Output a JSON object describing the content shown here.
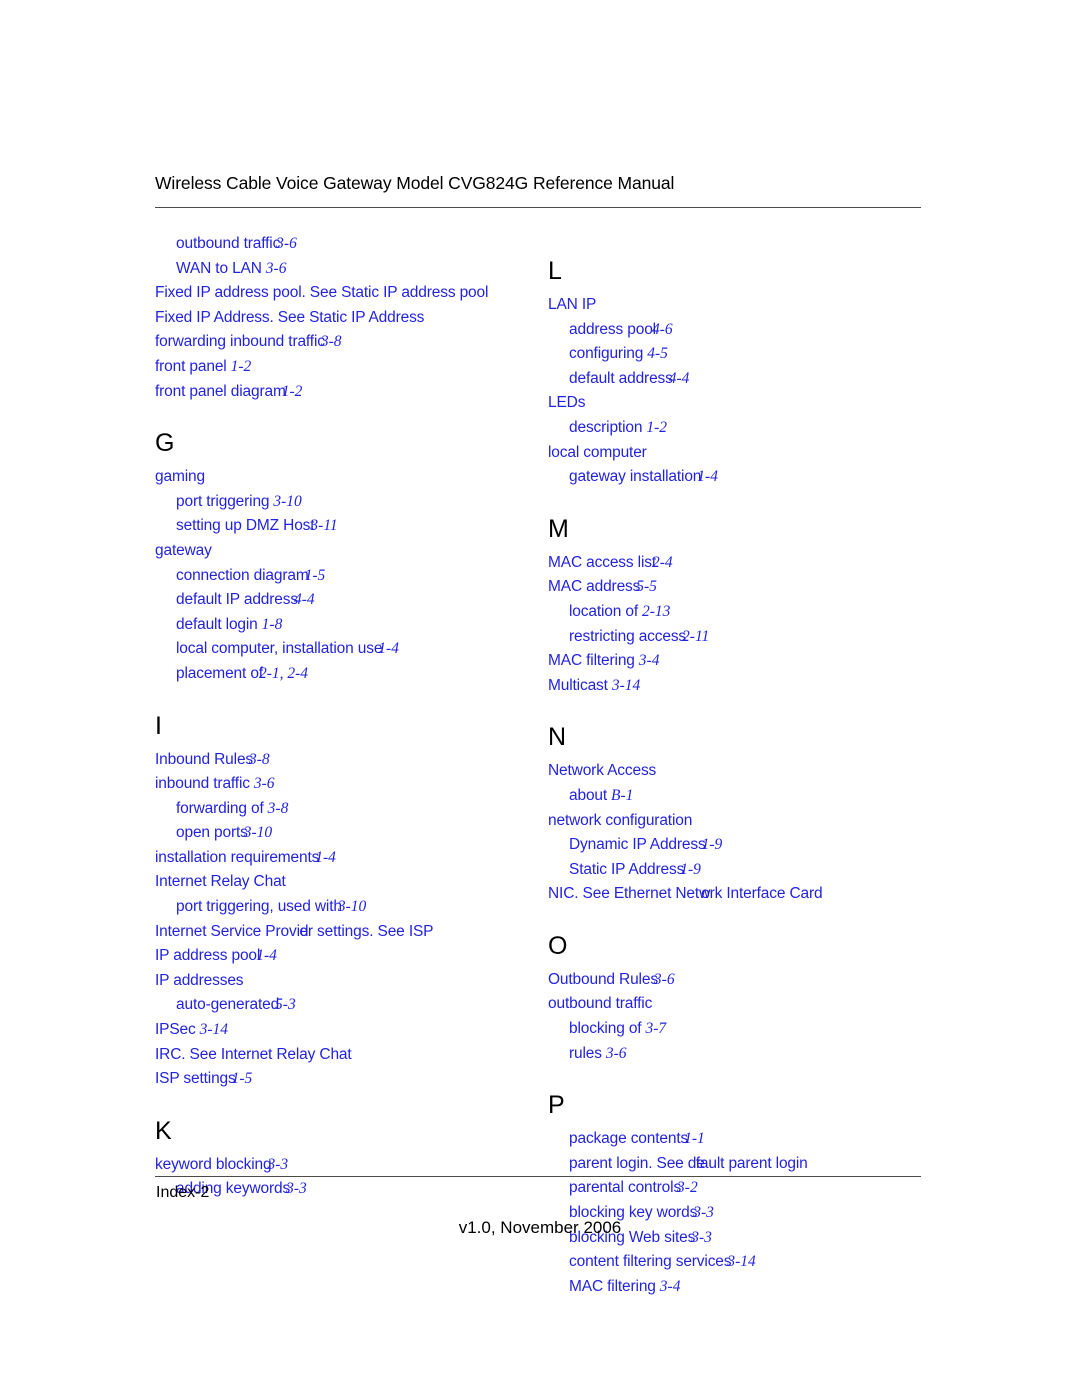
{
  "header": {
    "title": "Wireless Cable Voice Gateway Model CVG824G Reference Manual"
  },
  "footer": {
    "index_label": "Index-2",
    "version": "v1.0, November 2006"
  },
  "colors": {
    "link_blue": "#2323dd",
    "text_black": "#000000",
    "rule_gray": "#4a4a4a"
  },
  "columns": {
    "left": {
      "continued_entries": [
        {
          "level": 1,
          "text": "outbound traffic",
          "page": "3-6",
          "tight": true
        },
        {
          "level": 1,
          "text": "WAN to LAN",
          "page": "3-6",
          "tight": false
        }
      ],
      "pre_sections": [
        {
          "level": 0,
          "text": "Fixed IP address pool. See Static IP address pool",
          "page": ""
        },
        {
          "level": 0,
          "text": "Fixed IP Address. See Static IP Address",
          "page": ""
        },
        {
          "level": 0,
          "text": "forwarding inbound traffic",
          "page": "3-8",
          "tight": true
        },
        {
          "level": 0,
          "text": "front panel",
          "page": "1-2",
          "tight": false
        },
        {
          "level": 0,
          "text": "front panel diagram",
          "page": "1-2",
          "tight": true
        }
      ],
      "sections": [
        {
          "letter": "G",
          "entries": [
            {
              "level": 0,
              "text": "gaming",
              "page": ""
            },
            {
              "level": 1,
              "text": "port triggering",
              "page": "3-10",
              "tight": false
            },
            {
              "level": 1,
              "text": "setting up DMZ Host",
              "page": "3-11",
              "tight": true
            },
            {
              "level": 0,
              "text": "gateway",
              "page": ""
            },
            {
              "level": 1,
              "text": "connection diagram",
              "page": "1-5",
              "tight": true
            },
            {
              "level": 1,
              "text": "default IP address",
              "page": "4-4",
              "tight": true
            },
            {
              "level": 1,
              "text": "default login",
              "page": "1-8",
              "tight": false
            },
            {
              "level": 1,
              "text": "local computer, installation use",
              "page": "1-4",
              "tight": true
            },
            {
              "level": 1,
              "text": "placement of",
              "page": "2-1, 2-4",
              "tight": true
            }
          ]
        },
        {
          "letter": "I",
          "entries": [
            {
              "level": 0,
              "text": "Inbound Rules",
              "page": "3-8",
              "tight": true
            },
            {
              "level": 0,
              "text": "inbound traffic",
              "page": "3-6",
              "tight": false
            },
            {
              "level": 1,
              "text": "forwarding of",
              "page": "3-8",
              "tight": false
            },
            {
              "level": 1,
              "text": "open ports",
              "page": "3-10",
              "tight": true
            },
            {
              "level": 0,
              "text": "installation requirements",
              "page": "1-4",
              "tight": true
            },
            {
              "level": 0,
              "text": "Internet Relay Chat",
              "page": ""
            },
            {
              "level": 1,
              "text": "port triggering, used with",
              "page": "3-10",
              "tight": true
            },
            {
              "level": 0,
              "text": "Internet Service Provider settings. See ISP",
              "page": "",
              "overlap_at": 23
            },
            {
              "level": 0,
              "text": "IP address pool",
              "page": "1-4",
              "tight": true
            },
            {
              "level": 0,
              "text": "IP addresses",
              "page": ""
            },
            {
              "level": 1,
              "text": "auto-generated",
              "page": "5-3",
              "tight": true
            },
            {
              "level": 0,
              "text": "IPSec",
              "page": "3-14",
              "tight": false
            },
            {
              "level": 0,
              "text": "IRC. See Internet Relay Chat",
              "page": ""
            },
            {
              "level": 0,
              "text": "ISP settings",
              "page": "1-5",
              "tight": true
            }
          ]
        },
        {
          "letter": "K",
          "entries": [
            {
              "level": 0,
              "text": "keyword blocking",
              "page": "3-3",
              "tight": true
            },
            {
              "level": 1,
              "text": "adding keywords",
              "page": "3-3",
              "tight": true
            }
          ]
        }
      ]
    },
    "right": {
      "continued_entries": [],
      "pre_sections": [],
      "sections": [
        {
          "letter": "L",
          "entries": [
            {
              "level": 0,
              "text": "LAN IP",
              "page": ""
            },
            {
              "level": 1,
              "text": "address pool",
              "page": "4-6",
              "tight": true
            },
            {
              "level": 1,
              "text": "configuring",
              "page": "4-5",
              "tight": false
            },
            {
              "level": 1,
              "text": "default address",
              "page": "4-4",
              "tight": true
            },
            {
              "level": 0,
              "text": "LEDs",
              "page": ""
            },
            {
              "level": 1,
              "text": "description",
              "page": "1-2",
              "tight": false
            },
            {
              "level": 0,
              "text": "local computer",
              "page": ""
            },
            {
              "level": 1,
              "text": "gateway installation",
              "page": "1-4",
              "tight": true
            }
          ]
        },
        {
          "letter": "M",
          "entries": [
            {
              "level": 0,
              "text": "MAC access list",
              "page": "2-4",
              "tight": true
            },
            {
              "level": 0,
              "text": "MAC address",
              "page": "5-5",
              "tight": true
            },
            {
              "level": 1,
              "text": "location of",
              "page": "2-13",
              "tight": false
            },
            {
              "level": 1,
              "text": "restricting access",
              "page": "2-11",
              "tight": true
            },
            {
              "level": 0,
              "text": "MAC filtering",
              "page": "3-4",
              "tight": false
            },
            {
              "level": 0,
              "text": "Multicast",
              "page": "3-14",
              "tight": false
            }
          ]
        },
        {
          "letter": "N",
          "entries": [
            {
              "level": 0,
              "text": "Network Access",
              "page": ""
            },
            {
              "level": 1,
              "text": "about",
              "page": "B-1",
              "tight": false
            },
            {
              "level": 0,
              "text": "network configuration",
              "page": ""
            },
            {
              "level": 1,
              "text": "Dynamic IP Address",
              "page": "1-9",
              "tight": true
            },
            {
              "level": 1,
              "text": "Static IP Address",
              "page": "1-9",
              "tight": true
            },
            {
              "level": 0,
              "text": "NIC. See Ethernet Network Interface Card",
              "page": "",
              "overlap_at": 22
            }
          ]
        },
        {
          "letter": "O",
          "entries": [
            {
              "level": 0,
              "text": "Outbound Rules",
              "page": "3-6",
              "tight": true
            },
            {
              "level": 0,
              "text": "outbound traffic",
              "page": ""
            },
            {
              "level": 1,
              "text": "blocking of",
              "page": "3-7",
              "tight": false
            },
            {
              "level": 1,
              "text": "rules",
              "page": "3-6",
              "tight": false
            }
          ]
        },
        {
          "letter": "P",
          "entries": [
            {
              "level": 1,
              "text": "package contents",
              "page": "1-1",
              "tight": true
            },
            {
              "level": 1,
              "text": "parent login. See default parent login",
              "page": "",
              "overlap_at": 20
            },
            {
              "level": 1,
              "text": "parental controls",
              "page": "3-2",
              "tight": true
            },
            {
              "level": 2,
              "text": "blocking key words",
              "page": "3-3",
              "tight": true
            },
            {
              "level": 2,
              "text": "blocking Web sites",
              "page": "3-3",
              "tight": true
            },
            {
              "level": 2,
              "text": "content filtering services",
              "page": "3-14",
              "tight": true
            },
            {
              "level": 2,
              "text": "MAC filtering",
              "page": "3-4",
              "tight": false
            }
          ]
        }
      ]
    }
  }
}
